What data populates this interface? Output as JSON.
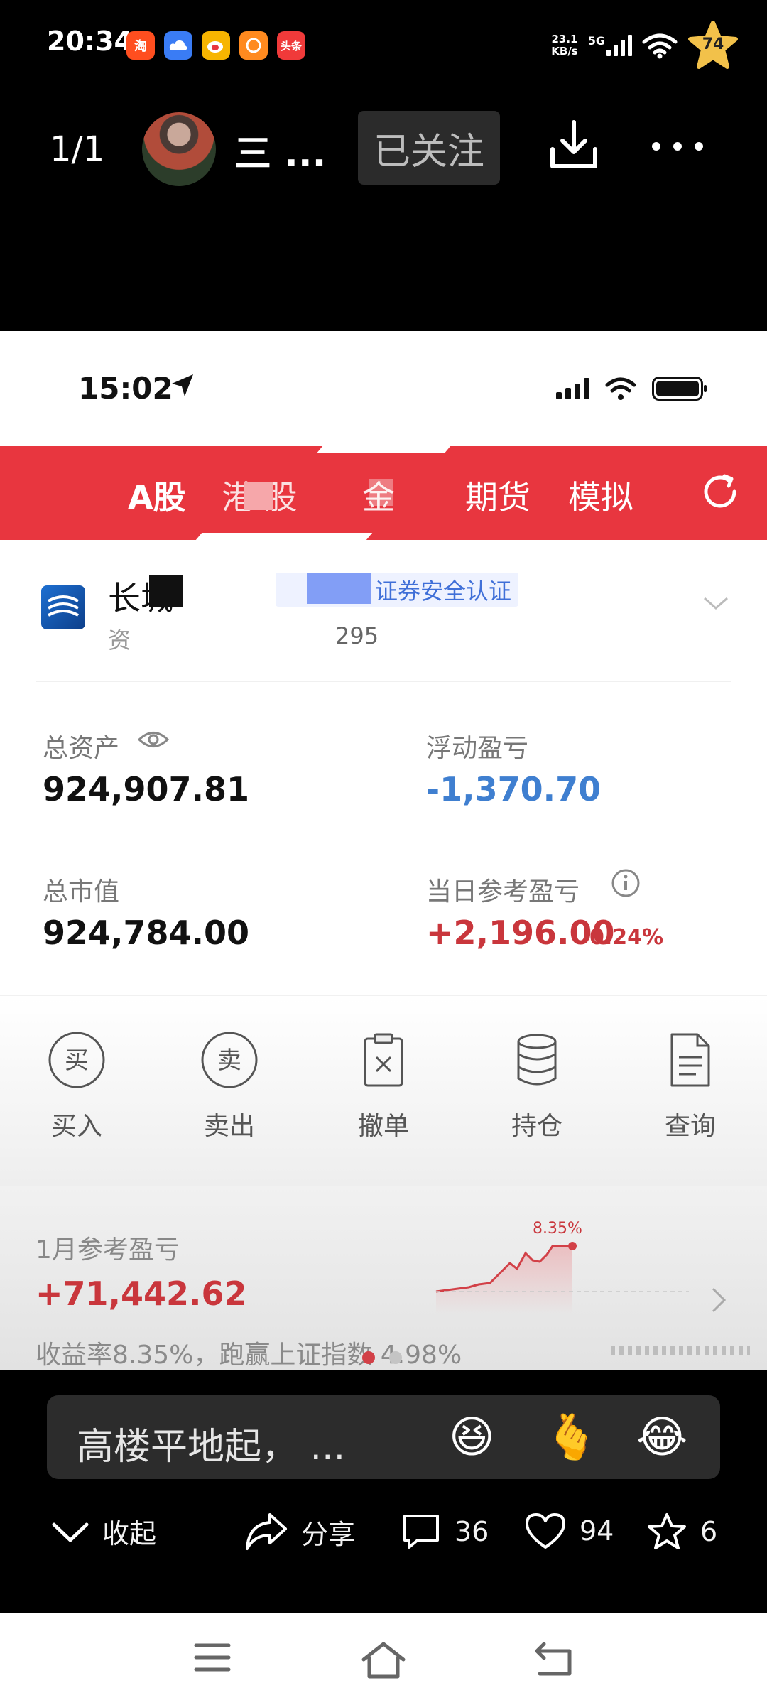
{
  "status_bar": {
    "time": "20:34",
    "apps": [
      {
        "icon": "taobao-icon",
        "label": "淘",
        "color": "#ff4e1f"
      },
      {
        "icon": "cloud-icon",
        "label": "",
        "color": "#3a7cf5"
      },
      {
        "icon": "weibo-icon",
        "label": "",
        "color": "#f7b500"
      },
      {
        "icon": "meituan-icon",
        "label": "",
        "color": "#ff8a1f"
      },
      {
        "icon": "toutiao-icon",
        "label": "头条",
        "color": "#f03a3a"
      }
    ],
    "net_speed": "23.1",
    "net_unit": "KB/s",
    "network": "5G",
    "badge_count": "74"
  },
  "viewer": {
    "page_counter": "1/1",
    "author_name": "三 ...",
    "follow_label": "已关注"
  },
  "screenshot": {
    "inner_time": "15:02",
    "tabs": [
      {
        "label": "A股",
        "active": true
      },
      {
        "label": "港 股",
        "active": false
      },
      {
        "label": "金",
        "active": false
      },
      {
        "label": "期货",
        "active": false
      },
      {
        "label": "模拟",
        "active": false
      }
    ],
    "account": {
      "broker": "长城",
      "cert": "证券安全认证",
      "sub": "资",
      "account_no": "295"
    },
    "assets": {
      "total_assets_label": "总资产",
      "total_assets": "924,907.81",
      "float_pl_label": "浮动盈亏",
      "float_pl": "-1,370.70",
      "market_value_label": "总市值",
      "market_value": "924,784.00",
      "daily_pl_label": "当日参考盈亏",
      "daily_pl": "+2,196.00",
      "daily_pct": "0.24%"
    },
    "actions": [
      {
        "label": "买入",
        "icon": "buy-icon",
        "glyph": "买"
      },
      {
        "label": "卖出",
        "icon": "sell-icon",
        "glyph": "卖"
      },
      {
        "label": "撤单",
        "icon": "cancel-order-icon"
      },
      {
        "label": "持仓",
        "icon": "holdings-icon"
      },
      {
        "label": "查询",
        "icon": "query-icon"
      }
    ],
    "monthly": {
      "label": "1月参考盈亏",
      "value": "+71,442.62",
      "desc": "收益率8.35%，跑赢上证指数 4.98%",
      "spark_label": "8.35%"
    }
  },
  "caption": {
    "text": "高楼平地起， ...",
    "emojis": [
      "😆",
      "🫰",
      "😂"
    ]
  },
  "action_bar": {
    "collapse_label": "收起",
    "share_label": "分享",
    "comment_count": "36",
    "like_count": "94",
    "favorite_count": "6"
  },
  "colors": {
    "brand_red": "#e8363f",
    "gain_red": "#c9363c",
    "loss_blue": "#3f7fd0"
  }
}
